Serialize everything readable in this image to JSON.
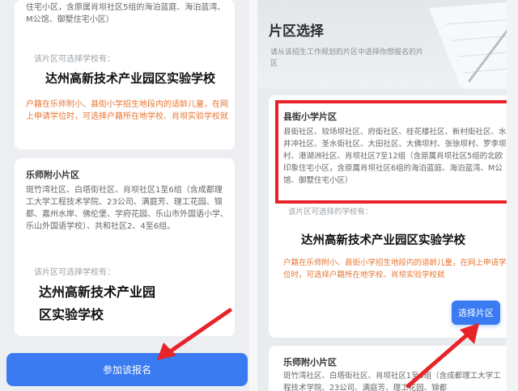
{
  "left": {
    "top_fragment": "住宅小区，含原属肖坝社区5组的海泊蓝庭、海泊蓝湾、M公馆、御墅住宅小区）",
    "card1": {
      "label": "该片区可选择学校有：",
      "school": "达州高新技术产业园区实验学校",
      "note": "户籍在乐师附小、县街小学招生地段内的适龄儿童，在网上申请学位时，可选择户籍所在地学校、肖坝实验学校就"
    },
    "card2": {
      "title": "乐师附小片区",
      "desc": "斑竹湾社区、白塔街社区、肖坝社区1至6组（含成都理工大学工程技术学院、23公司、满庭芳、理工花园、锦都、嘉州水岸、佛伦堡、学府花园、乐山市外国语小学、乐山外国语学校）、共和社区2、4至6组。",
      "label": "该片区可选择学校有：",
      "school_line1": "达州高新技术产业园",
      "school_line2": "区实验学校"
    },
    "join_button": "参加该报名"
  },
  "right": {
    "header_title": "片区选择",
    "header_subtitle": "请从该招生工作规划的片区中选择你想报名的片区",
    "card1": {
      "title": "县街小学片区",
      "desc": "县街社区、较场坝社区、府街社区、桂花楼社区、新村街社区、水井冲社区、圣水街社区、大田社区、大佛坝村、张徐坝村、罗李坝村、港湖洲社区、肖坝社区7至12组（含原属肖坝社区5组的北欧印象住宅小区，含原属肖坝社区6组的海泊蓝庭、海泊蓝湾、M公馆、御墅住宅小区）",
      "label": "该片区可选择的学校有：",
      "school": "达州高新技术产业园区实验学校",
      "note": "户籍在乐师附小、县街小学招生地段内的适龄儿童，在网上申请学位时，可选择户籍所在地学校、肖坝实验学校就",
      "select_button": "选择片区"
    },
    "card2": {
      "title": "乐师附小片区",
      "desc": "斑竹湾社区、白塔街社区、肖坝社区1至6组（含成都理工大学工程技术学院、23公司、满庭芳、理工花园、锦都"
    }
  },
  "colors": {
    "accent": "#3a7bf2",
    "highlight": "#e8232a",
    "note": "#e8742f"
  }
}
